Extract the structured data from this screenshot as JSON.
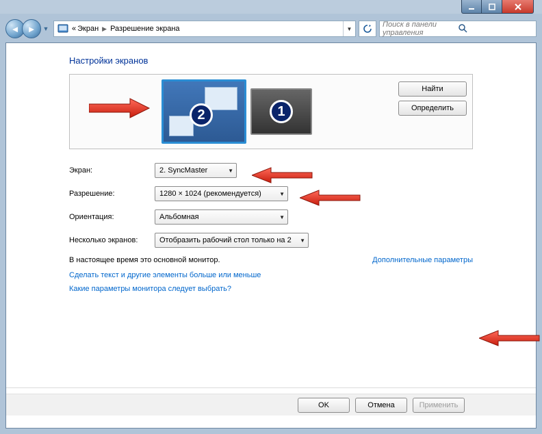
{
  "address": {
    "back_sep": "«",
    "seg1": "Экран",
    "seg2": "Разрешение экрана"
  },
  "search": {
    "placeholder": "Поиск в панели управления"
  },
  "heading": "Настройки экранов",
  "side_buttons": {
    "find": "Найти",
    "identify": "Определить"
  },
  "monitors": {
    "num2": "2",
    "num1": "1"
  },
  "labels": {
    "display": "Экран:",
    "resolution": "Разрешение:",
    "orientation": "Ориентация:",
    "multi": "Несколько экранов:"
  },
  "values": {
    "display": "2. SyncMaster",
    "resolution": "1280 × 1024 (рекомендуется)",
    "orientation": "Альбомная",
    "multi": "Отобразить рабочий стол только на 2"
  },
  "note_text": "В настоящее время это основной монитор.",
  "link_advanced": "Дополнительные параметры",
  "link_textsize": "Сделать текст и другие элементы больше или меньше",
  "link_which": "Какие параметры монитора следует выбрать?",
  "buttons": {
    "ok": "OK",
    "cancel": "Отмена",
    "apply": "Применить"
  }
}
